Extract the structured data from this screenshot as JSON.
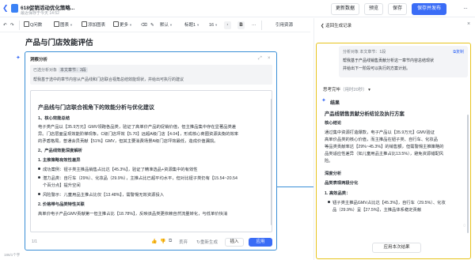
{
  "header": {
    "doc_title": "618促销活动优化策略...",
    "doc_subtitle": "最近保存于今天 14:52",
    "buttons": [
      "更新数据",
      "预览",
      "保存",
      "保存并发布"
    ],
    "more": "···"
  },
  "toolbar": {
    "items": [
      "Q问数",
      "图表",
      "添加图表",
      "更多"
    ],
    "style": "默认",
    "heading": "标题1",
    "size": "16",
    "bold": "B",
    "ref": "引用资源"
  },
  "document": {
    "title": "产品与门店效能评估"
  },
  "panel": {
    "heading": "洞察分析",
    "ctx_label": "已选分析对象",
    "ctx_chip": "本文章节",
    "ctx_count": "3段",
    "ctx_desc": "帮我基于选中的章节内容从产品线和门店联合视角总结效能现状，并给出可执行的建议",
    "content": {
      "title": "产品线与门店联合视角下的效能分析与优化建议",
      "s1": "1、核心效能总结",
      "p1a": "电子类产品以【35.9万元】GMV领跑各品类，验证了高单价产品的促销价值，但主推品集中存在显著品类差",
      "p1b": "异。门店层面呈现效能阶梯现象，C级门店坪效【5.70】远超A级门店【4.04】，形成核心商圈资源失衡的效率",
      "p1c": "的矛盾格局。普通会员贡献【51%】GMV，但其主要消费场景A级门店坪效最低，造成价值漏损。",
      "s2": "2、产品线效能深度解析",
      "s2a": "1. 主推策略有效性差异",
      "b1": "成功案例：钮子类主推品销售占比达【45.3%】，验证了精准选品+资源集中的有效性",
      "b2a": "潜力品类：自行车（29%）、化妆品（29.9%），主推占比已超平均水平，但对比钮子类仍有【15.54~20.54",
      "b2b": "个百分点】提升空间",
      "b3": "风险警示：儿童用品主推占比仅【13.48%】，需警惕无效资源投入",
      "s2b": "2. 价格带与品类特性关联",
      "p2": "高单价电子产品GMV贡献第一但主推占比【18.78%】，反映该品类更依赖自然流量转化，与低单价快消"
    },
    "footer": {
      "count": "1/1",
      "discard": "丢弃",
      "regen": "重新生成",
      "insert": "插入",
      "apply": "应用"
    }
  },
  "wordcount": "186/1个字",
  "right": {
    "back": "返回生成记录",
    "close": "×",
    "q_label": "分析对象",
    "q_chip": "本文章节：1段",
    "q_copy": "复制",
    "q_line1": "帮我基于产品线销售贡献分析这一章节内容总结现状",
    "q_line2": "并给出下一阶段可以执行的方案计划。",
    "think": "思考完毕",
    "think_sub": "（用时20秒）",
    "result_title": "结果",
    "r_title": "产品线销售贡献分析结论及执行方案",
    "r_s1": "核心结论",
    "r_p1": "通过集中资源打造爆款，电子产品以【35.9万元】GMV验证",
    "r_p2": "高单价品类的核心价值，而主推品在钮子类、自行车、化妆品",
    "r_p3": "等品类贡献率达【29%~45.3%】的销售额，但需警惕主推策略的",
    "r_p4": "品类适应性差异（如儿童用品主推占比13.5%），避免资源错配风",
    "r_p5": "险。",
    "r_s2": "深度分析",
    "r_s3": "品类表现两极分化",
    "r_s4": "1. 高效品类：",
    "r_b1a": "钮子类主推品GMV占比达【45.3%】，自行车（29.5%）、化妆",
    "r_b1b": "品（29.9%）呈【27.5%】，主推品体系稳定贡献",
    "apply": "应用本次结果"
  }
}
